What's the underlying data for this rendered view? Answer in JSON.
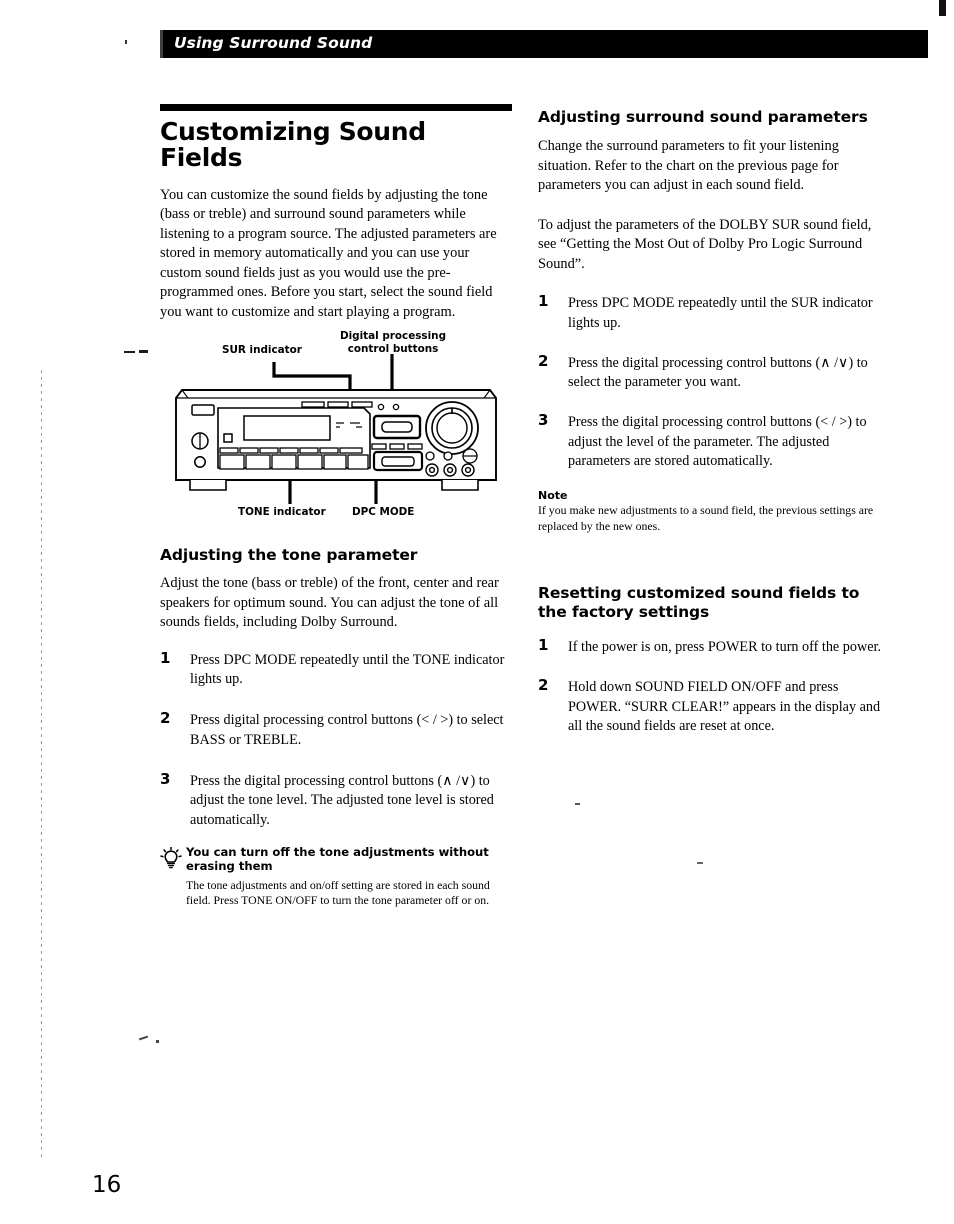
{
  "header": {
    "section_title": "Using Surround Sound"
  },
  "page": {
    "number": "16"
  },
  "left": {
    "heading": "Customizing Sound Fields",
    "intro": "You can customize the sound fields by adjusting the tone (bass or treble) and surround sound parameters while listening to a program source. The adjusted parameters are stored in memory automatically and you can use your custom sound fields just as you would use the pre-programmed ones. Before you start, select the sound field you want to customize and start playing a program.",
    "tone_section": {
      "heading": "Adjusting the tone parameter",
      "intro": "Adjust the tone (bass or treble) of the front, center and rear speakers for optimum sound. You can adjust the tone of all sounds fields, including Dolby Surround.",
      "steps": [
        {
          "num": "1",
          "text": "Press DPC MODE repeatedly until the TONE indicator lights up."
        },
        {
          "num": "2",
          "text": "Press digital processing control buttons (< / >) to select BASS or TREBLE."
        },
        {
          "num": "3",
          "text": "Press the digital processing control buttons (∧ /∨) to adjust the tone level. The adjusted tone level is stored automatically."
        }
      ]
    },
    "tip": {
      "icon": "lightbulb-icon",
      "title": "You can turn off the tone adjustments without erasing them",
      "body": "The tone adjustments and on/off setting are stored in each sound field. Press TONE ON/OFF to turn the tone parameter off or on."
    }
  },
  "right": {
    "surround_section": {
      "heading": "Adjusting surround sound parameters",
      "para1": "Change the surround parameters to fit your listening situation. Refer to the chart on the previous page for parameters you can adjust in each sound field.",
      "para2": "To adjust the parameters of the DOLBY SUR sound field, see “Getting the Most Out of Dolby Pro Logic Surround Sound”.",
      "steps": [
        {
          "num": "1",
          "text": "Press DPC MODE repeatedly until the SUR indicator lights up."
        },
        {
          "num": "2",
          "text": "Press the digital processing control buttons (∧ /∨) to select the parameter you want."
        },
        {
          "num": "3",
          "text": "Press the digital processing control buttons (< / >) to adjust the level of the parameter. The adjusted parameters are stored automatically."
        }
      ]
    },
    "note": {
      "title": "Note",
      "body": "If you make new adjustments to a sound field, the previous settings are replaced by the new ones."
    },
    "reset_section": {
      "heading": "Resetting customized sound fields to the factory settings",
      "steps": [
        {
          "num": "1",
          "text": "If the power is on, press POWER to turn off the power."
        },
        {
          "num": "2",
          "text": "Hold down SOUND FIELD ON/OFF and press POWER. “SURR CLEAR!” appears in the display and all the sound fields are reset at once."
        }
      ]
    }
  },
  "figure": {
    "description": "Front panel of an audio receiver with callout labels",
    "callouts": {
      "sur_indicator": "SUR indicator",
      "dpc_buttons_line1": "Digital processing",
      "dpc_buttons_line2": "control buttons",
      "tone_indicator": "TONE indicator",
      "dpc_mode": "DPC MODE"
    }
  }
}
